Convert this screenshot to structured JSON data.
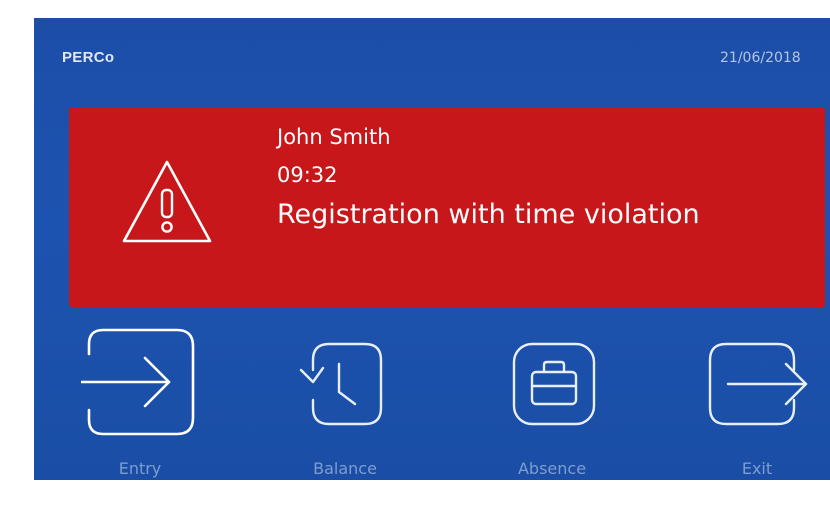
{
  "header": {
    "brand": "PERCo",
    "date": "21/06/2018"
  },
  "alert": {
    "icon": "warning-triangle-icon",
    "background_color": "#c8171a",
    "name": "John Smith",
    "time": "09:32",
    "message": "Registration with time violation"
  },
  "actions": [
    {
      "label": "Entry",
      "icon": "entry-arrow-icon",
      "active": true
    },
    {
      "label": "Balance",
      "icon": "balance-clock-icon",
      "active": false
    },
    {
      "label": "Absence",
      "icon": "briefcase-icon",
      "active": false
    },
    {
      "label": "Exit",
      "icon": "exit-arrow-icon",
      "active": false
    }
  ],
  "colors": {
    "background": "#1d51ac",
    "alert": "#c8171a",
    "icon_active": "#ffffff",
    "icon_inactive": "#e9effa",
    "label": "#7f9ccf"
  }
}
